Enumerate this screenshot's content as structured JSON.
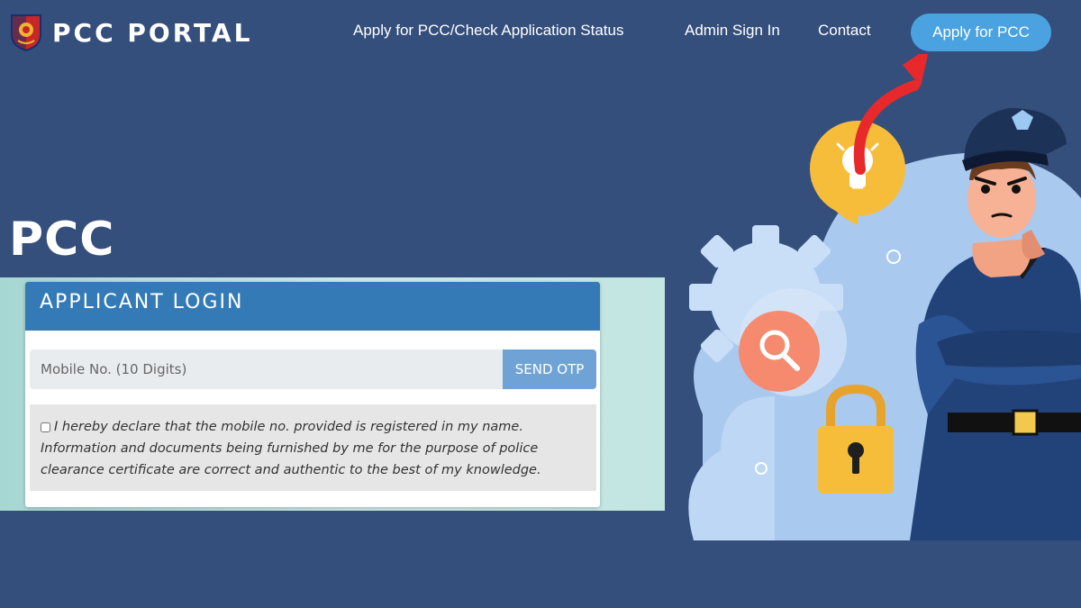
{
  "header": {
    "brand": "PCC PORTAL",
    "nav": [
      "Apply for PCC/Check Application Status",
      "Admin Sign In",
      "Contact"
    ],
    "cta": "Apply for PCC"
  },
  "hero": {
    "title": "PCC"
  },
  "login": {
    "title": "APPLICANT LOGIN",
    "mobile_placeholder": "Mobile No. (10 Digits)",
    "send_otp": "SEND OTP",
    "declaration": "I hereby declare that the mobile no. provided is registered in my name. Information and documents being furnished by me for the purpose of police clearance certificate are correct and authentic to the best of my knowledge."
  },
  "colors": {
    "background": "#344f7c",
    "cta": "#4aa3e0",
    "panel_header": "#337ab7",
    "otp_button": "#6fa3d6",
    "arrow": "#e8292b"
  },
  "icons": [
    "police-emblem-icon",
    "lightbulb-icon",
    "search-icon",
    "padlock-icon",
    "gear-icon"
  ]
}
